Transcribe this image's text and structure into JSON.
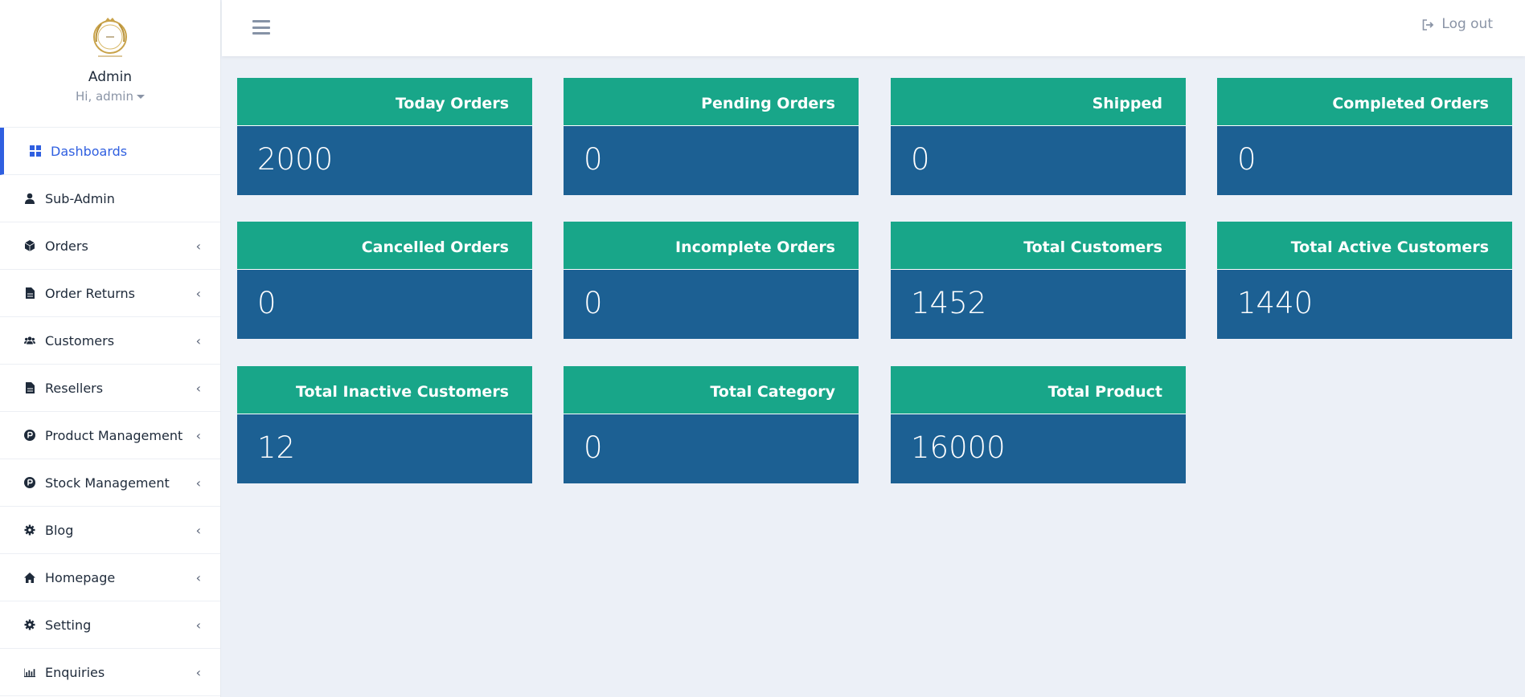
{
  "sidebar": {
    "user": {
      "name": "Admin",
      "greeting": "Hi, admin"
    },
    "items": [
      {
        "label": "Dashboards",
        "icon": "grid-icon",
        "active": true
      },
      {
        "label": "Sub-Admin",
        "icon": "user-icon"
      },
      {
        "label": "Orders",
        "icon": "cube-icon"
      },
      {
        "label": "Order Returns",
        "icon": "file-icon"
      },
      {
        "label": "Customers",
        "icon": "users-icon"
      },
      {
        "label": "Resellers",
        "icon": "file-icon"
      },
      {
        "label": "Product Management",
        "icon": "product-icon"
      },
      {
        "label": "Stock Management",
        "icon": "product-icon"
      },
      {
        "label": "Blog",
        "icon": "gear-icon"
      },
      {
        "label": "Homepage",
        "icon": "home-icon"
      },
      {
        "label": "Setting",
        "icon": "gear-icon"
      },
      {
        "label": "Enquiries",
        "icon": "bar-chart-icon"
      }
    ]
  },
  "topbar": {
    "logout_label": "Log out"
  },
  "cards": [
    {
      "title": "Today Orders",
      "value": "2000"
    },
    {
      "title": "Pending Orders",
      "value": "0"
    },
    {
      "title": "Shipped",
      "value": "0"
    },
    {
      "title": "Completed Orders",
      "value": "0"
    },
    {
      "title": "Cancelled Orders",
      "value": "0"
    },
    {
      "title": "Incomplete Orders",
      "value": "0"
    },
    {
      "title": "Total Customers",
      "value": "1452"
    },
    {
      "title": "Total Active Customers",
      "value": "1440"
    },
    {
      "title": "Total Inactive Customers",
      "value": "12"
    },
    {
      "title": "Total Category",
      "value": "0"
    },
    {
      "title": "Total Product",
      "value": "16000"
    }
  ],
  "colors": {
    "accent": "#2f5fe0",
    "card_header": "#18a689",
    "card_body": "#1c6093",
    "background": "#ecf0f7"
  }
}
